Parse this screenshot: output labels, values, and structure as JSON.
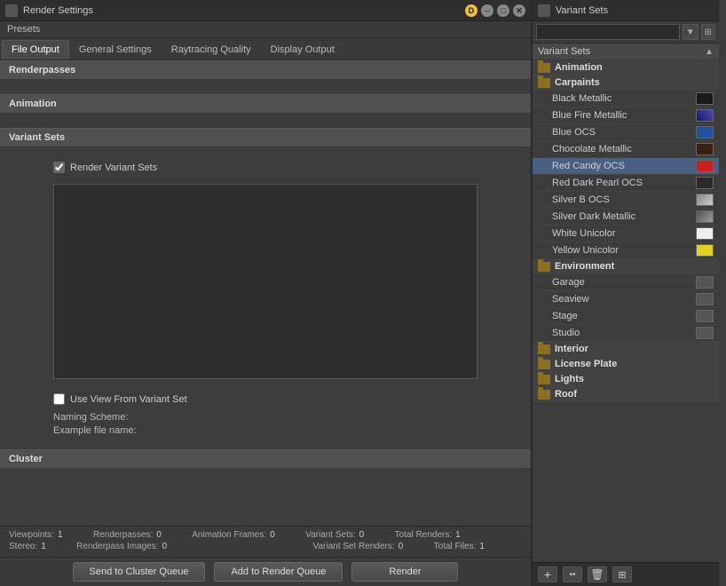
{
  "left_window": {
    "title": "Render Settings",
    "presets_label": "Presets",
    "tabs": [
      {
        "label": "File Output",
        "active": true
      },
      {
        "label": "General Settings",
        "active": false
      },
      {
        "label": "Raytracing Quality",
        "active": false
      },
      {
        "label": "Display Output",
        "active": false
      }
    ],
    "sections": {
      "renderpasses": "Renderpasses",
      "animation": "Animation",
      "variant_sets": "Variant Sets",
      "cluster": "Cluster"
    },
    "render_variant_sets_label": "Render Variant Sets",
    "use_view_label": "Use View From Variant Set",
    "naming_scheme_label": "Naming Scheme:",
    "example_file_label": "Example file name:",
    "naming_scheme_value": "",
    "example_file_value": "",
    "status": {
      "viewpoints_label": "Viewpoints:",
      "viewpoints_value": "1",
      "stereo_label": "Stereo:",
      "stereo_value": "1",
      "renderpasses_label": "Renderpasses:",
      "renderpasses_value": "0",
      "renderpass_images_label": "Renderpass Images:",
      "renderpass_images_value": "0",
      "animation_frames_label": "Animation Frames:",
      "animation_frames_value": "0",
      "variant_sets_label": "Variant Sets:",
      "variant_sets_value": "0",
      "variant_set_renders_label": "Variant Set Renders:",
      "variant_set_renders_value": "0",
      "total_renders_label": "Total Renders:",
      "total_renders_value": "1",
      "total_files_label": "Total Files:",
      "total_files_value": "1"
    },
    "buttons": {
      "send_to_cluster": "Send to Cluster Queue",
      "add_to_render": "Add to Render Queue",
      "render": "Render"
    }
  },
  "right_window": {
    "title": "Variant Sets",
    "search_placeholder": "",
    "column_label": "Variant Sets",
    "tree": [
      {
        "id": "animation",
        "type": "category",
        "label": "Animation",
        "indent": 0
      },
      {
        "id": "carpaints",
        "type": "category",
        "label": "Carpaints",
        "indent": 0
      },
      {
        "id": "black-metallic",
        "type": "item",
        "label": "Black Metallic",
        "indent": 1,
        "swatch": "black"
      },
      {
        "id": "blue-fire-metallic",
        "type": "item",
        "label": "Blue Fire Metallic",
        "indent": 1,
        "swatch": "blue-fire"
      },
      {
        "id": "blue-ocs",
        "type": "item",
        "label": "Blue OCS",
        "indent": 1,
        "swatch": "blue"
      },
      {
        "id": "chocolate-metallic",
        "type": "item",
        "label": "Chocolate Metallic",
        "indent": 1,
        "swatch": "choc"
      },
      {
        "id": "red-candy-ocs",
        "type": "item",
        "label": "Red Candy OCS",
        "indent": 1,
        "swatch": "red",
        "selected": true
      },
      {
        "id": "red-dark-pearl-ocs",
        "type": "item",
        "label": "Red Dark Pearl OCS",
        "indent": 1,
        "swatch": "dark-pearl"
      },
      {
        "id": "silver-b-ocs",
        "type": "item",
        "label": "Silver B OCS",
        "indent": 1,
        "swatch": "silver-b"
      },
      {
        "id": "silver-dark-metallic",
        "type": "item",
        "label": "Silver Dark Metallic",
        "indent": 1,
        "swatch": "silver-dark"
      },
      {
        "id": "white-unicolor",
        "type": "item",
        "label": "White Unicolor",
        "indent": 1,
        "swatch": "white"
      },
      {
        "id": "yellow-unicolor",
        "type": "item",
        "label": "Yellow Unicolor",
        "indent": 1,
        "swatch": "yellow"
      },
      {
        "id": "environment",
        "type": "category",
        "label": "Environment",
        "indent": 0
      },
      {
        "id": "garage",
        "type": "item",
        "label": "Garage",
        "indent": 1,
        "swatch": "env"
      },
      {
        "id": "seaview",
        "type": "item",
        "label": "Seaview",
        "indent": 1,
        "swatch": "env"
      },
      {
        "id": "stage",
        "type": "item",
        "label": "Stage",
        "indent": 1,
        "swatch": "env"
      },
      {
        "id": "studio",
        "type": "item",
        "label": "Studio",
        "indent": 1,
        "swatch": "env"
      },
      {
        "id": "interior",
        "type": "category",
        "label": "Interior",
        "indent": 0
      },
      {
        "id": "license-plate",
        "type": "category",
        "label": "License Plate",
        "indent": 0
      },
      {
        "id": "lights",
        "type": "category",
        "label": "Lights",
        "indent": 0
      },
      {
        "id": "roof",
        "type": "category",
        "label": "Roof",
        "indent": 0
      }
    ],
    "toolbar_buttons": [
      "+",
      "••",
      "🗑",
      "⊞"
    ]
  }
}
